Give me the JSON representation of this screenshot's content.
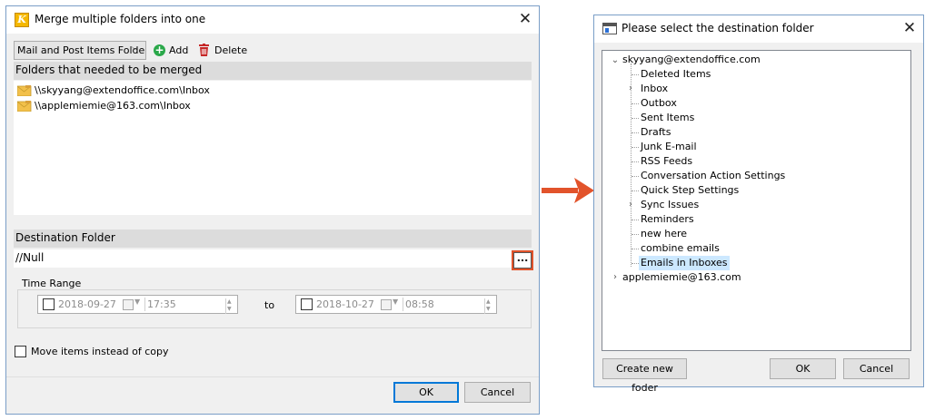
{
  "merge_dialog": {
    "title": "Merge multiple folders into one",
    "close_icon": "close-x",
    "folder_type_select": "Mail and Post Items Folde",
    "add_label": "Add",
    "delete_label": "Delete",
    "folders_header": "Folders that needed to be merged",
    "folders": [
      "\\\\skyyang@extendoffice.com\\Inbox",
      "\\\\applemiemie@163.com\\Inbox"
    ],
    "destination_header": "Destination Folder",
    "destination_value": "//Null",
    "browse_label": "...",
    "time_range_label": "Time Range",
    "start": {
      "date": "2018-09-27",
      "time": "17:35",
      "checked": false
    },
    "to_label": "to",
    "end": {
      "date": "2018-10-27",
      "time": "08:58",
      "checked": false
    },
    "move_items_label": "Move items instead of copy",
    "move_items_checked": false,
    "ok_label": "OK",
    "cancel_label": "Cancel"
  },
  "arrow_color": "#e2532b",
  "highlight_color": "#e2532b",
  "destination_dialog": {
    "title": "Please select the destination folder",
    "accounts": [
      {
        "label": "skyyang@extendoffice.com",
        "expanded": true,
        "children": [
          {
            "label": "Deleted Items",
            "expandable": false
          },
          {
            "label": "Inbox",
            "expandable": true
          },
          {
            "label": "Outbox",
            "expandable": false
          },
          {
            "label": "Sent Items",
            "expandable": false
          },
          {
            "label": "Drafts",
            "expandable": false
          },
          {
            "label": "Junk E-mail",
            "expandable": false
          },
          {
            "label": "RSS Feeds",
            "expandable": false
          },
          {
            "label": "Conversation Action Settings",
            "expandable": false
          },
          {
            "label": "Quick Step Settings",
            "expandable": false
          },
          {
            "label": "Sync Issues",
            "expandable": true
          },
          {
            "label": "Reminders",
            "expandable": false
          },
          {
            "label": "new here",
            "expandable": false
          },
          {
            "label": "combine emails",
            "expandable": false
          },
          {
            "label": "Emails in Inboxes",
            "expandable": false,
            "selected": true
          }
        ]
      },
      {
        "label": "applemiemie@163.com",
        "expanded": false
      }
    ],
    "create_folder_label": "Create new foder",
    "ok_label": "OK",
    "cancel_label": "Cancel"
  }
}
